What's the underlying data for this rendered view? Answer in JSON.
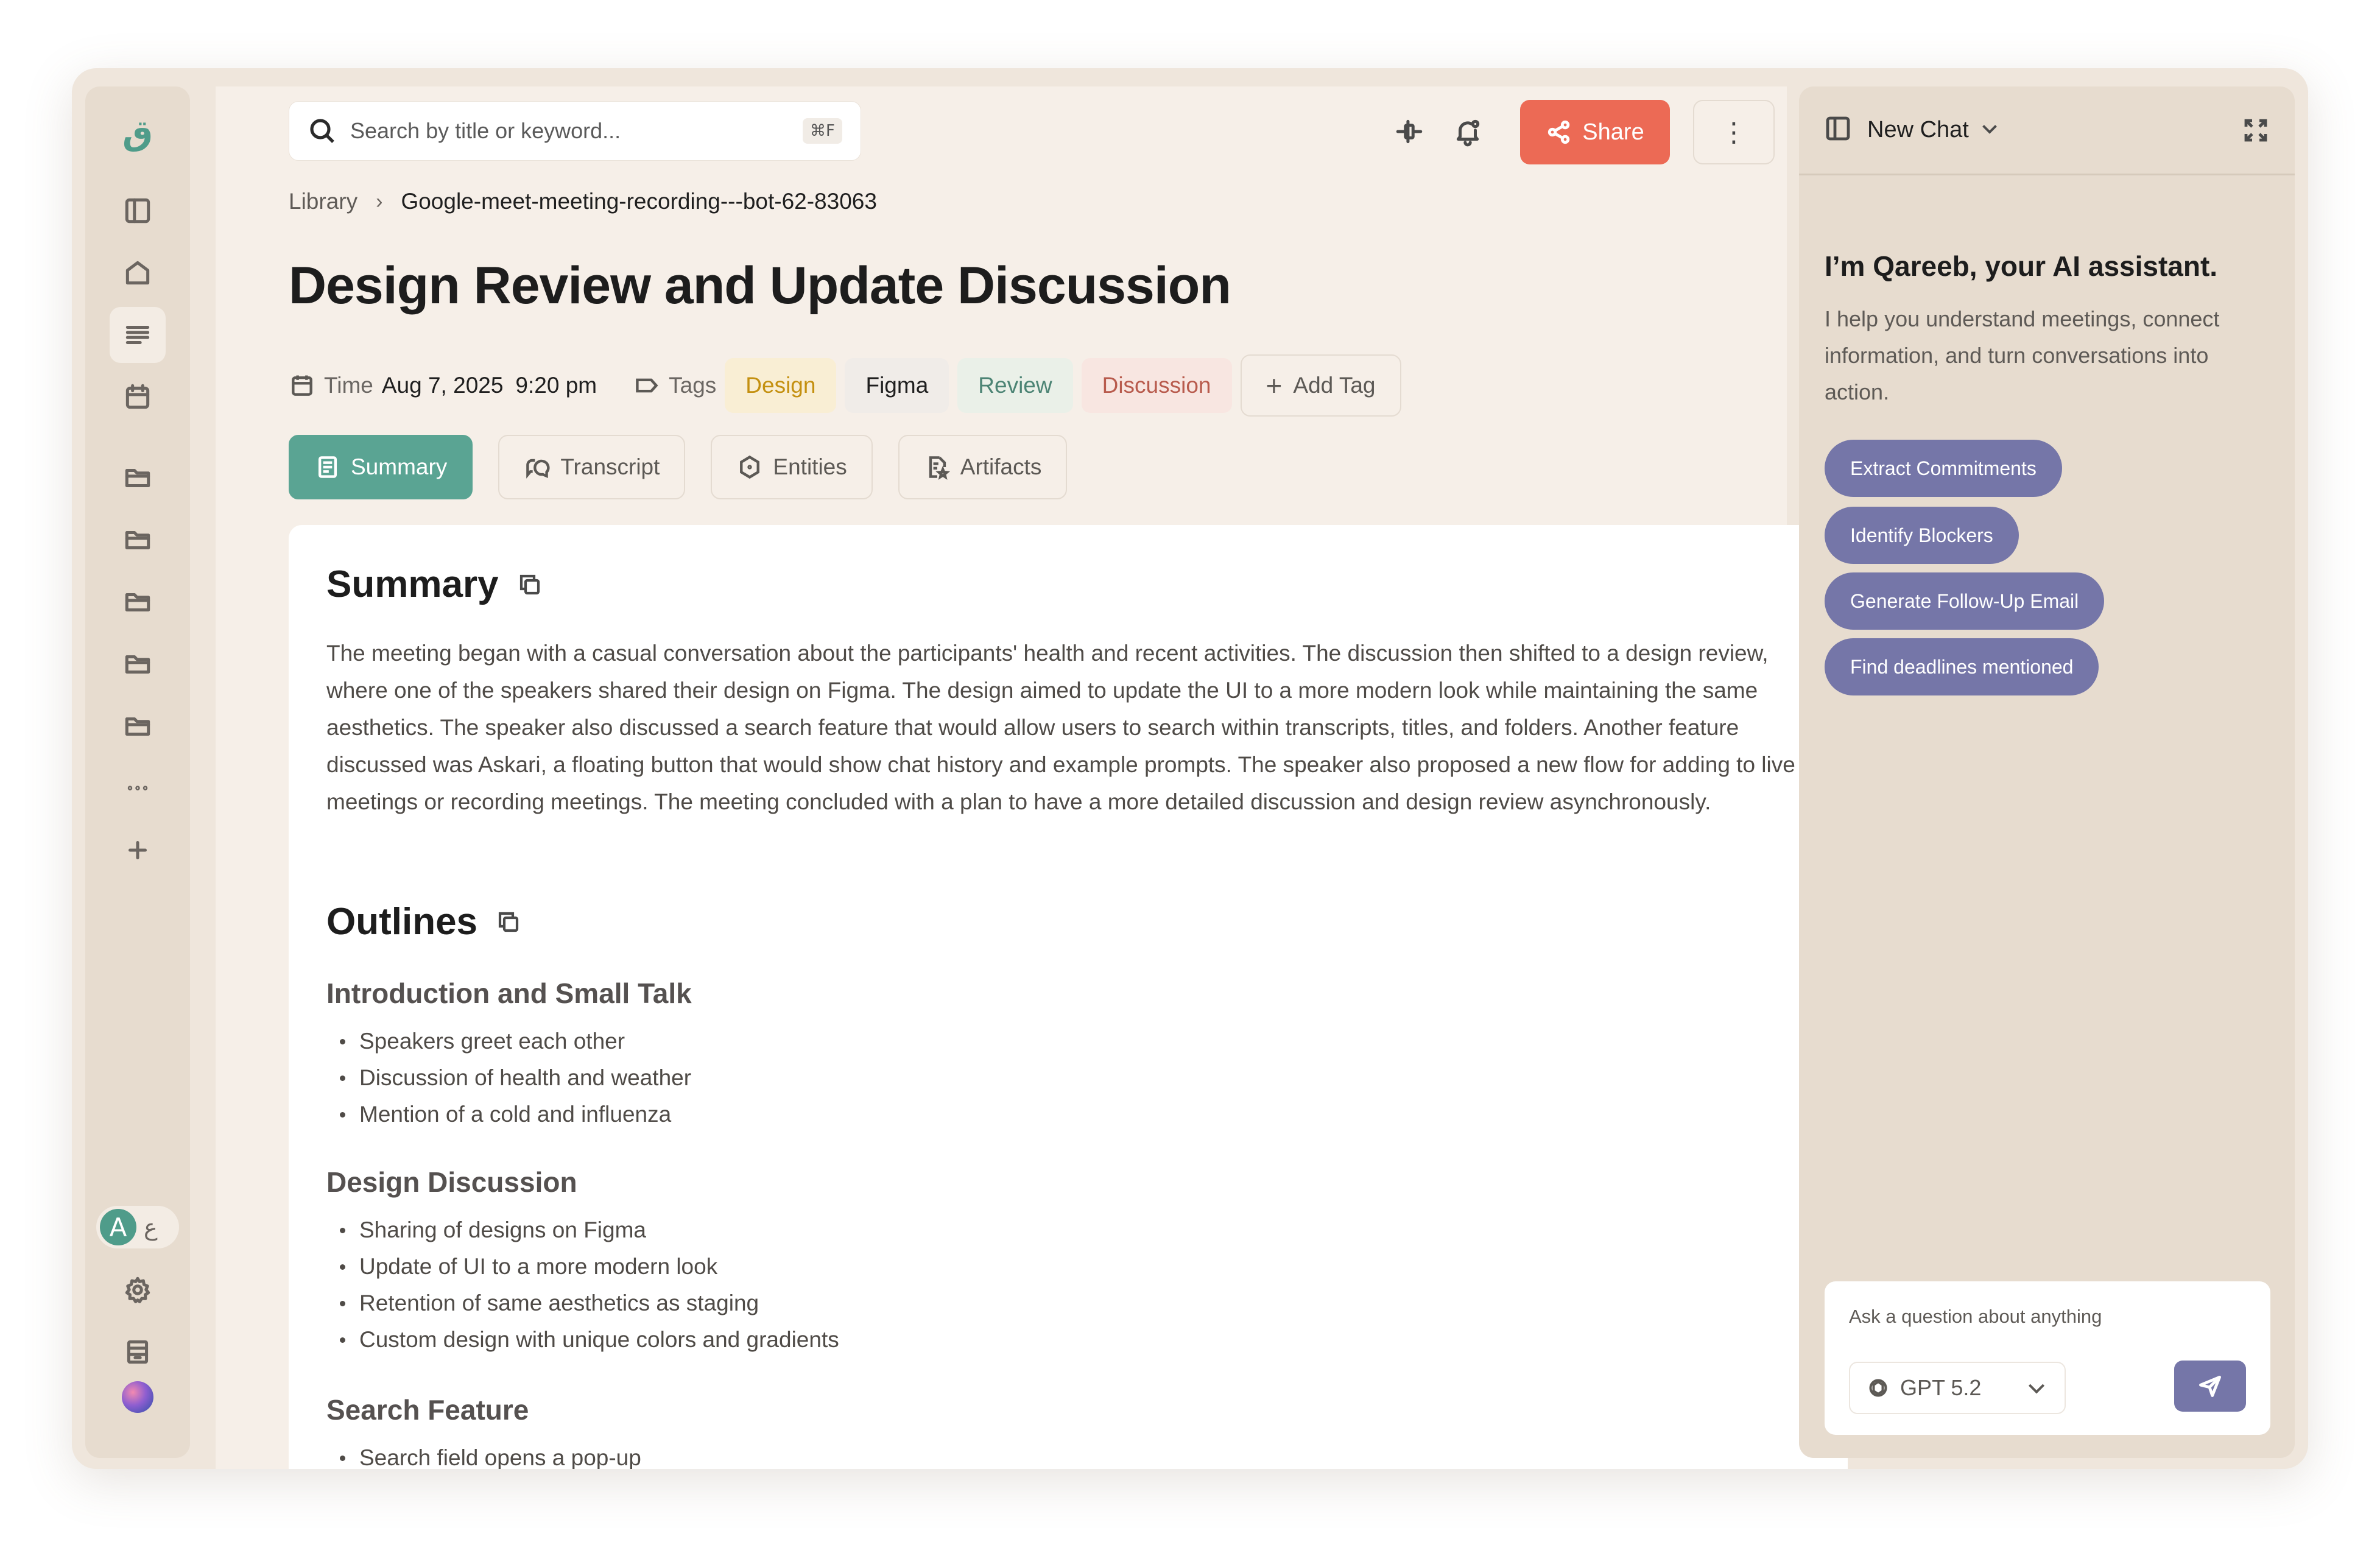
{
  "rail": {
    "logo": "ق",
    "lang_primary": "A",
    "lang_secondary": "ع"
  },
  "search": {
    "placeholder": "Search by title or keyword...",
    "shortcut": "⌘F"
  },
  "header": {
    "share_label": "Share",
    "more_label": "⋮"
  },
  "breadcrumb": {
    "root": "Library",
    "separator": "›",
    "current": "Google-meet-meeting-recording---bot-62-83063"
  },
  "page": {
    "title": "Design Review and Update Discussion",
    "time_label": "Time",
    "date": "Aug 7, 2025",
    "time": "9:20 pm",
    "tags_label": "Tags",
    "tags": [
      {
        "label": "Design",
        "color": "#c49010"
      },
      {
        "label": "Figma",
        "color": "#1f1f1f"
      },
      {
        "label": "Review",
        "color": "#4c8474"
      },
      {
        "label": "Discussion",
        "color": "#b85b4d"
      }
    ],
    "add_tag_label": "Add Tag"
  },
  "tabs": [
    {
      "label": "Summary",
      "active": true
    },
    {
      "label": "Transcript",
      "active": false
    },
    {
      "label": "Entities",
      "active": false
    },
    {
      "label": "Artifacts",
      "active": false
    }
  ],
  "content": {
    "summary_heading": "Summary",
    "summary_text": "The meeting began with a casual conversation about the participants' health and recent activities. The discussion then shifted to a design review, where one of the speakers shared their design on Figma. The design aimed to update the UI to a more modern look while maintaining the same aesthetics. The speaker also discussed a search feature that would allow users to search within transcripts, titles, and folders. Another feature discussed was Askari, a floating button that would show chat history and example prompts. The speaker also proposed a new flow for adding to live meetings or recording meetings. The meeting concluded with a plan to have a more detailed discussion and design review asynchronously.",
    "outlines_heading": "Outlines",
    "outlines": [
      {
        "title": "Introduction and Small Talk",
        "items": [
          "Speakers greet each other",
          "Discussion of health and weather",
          "Mention of a cold and influenza"
        ]
      },
      {
        "title": "Design Discussion",
        "items": [
          "Sharing of designs on Figma",
          "Update of UI to a more modern look",
          "Retention of same aesthetics as staging",
          "Custom design with unique colors and gradients"
        ]
      },
      {
        "title": "Search Feature",
        "items": [
          "Search field opens a pop-up"
        ]
      }
    ]
  },
  "chat": {
    "title": "New Chat",
    "greeting": "I’m Qareeb, your AI assistant.",
    "description": "I help you understand meetings, connect information, and turn conversations into action.",
    "prompts": [
      "Extract Commitments",
      "Identify Blockers",
      "Generate Follow-Up Email",
      "Find deadlines mentioned"
    ],
    "input_placeholder": "Ask a question about anything",
    "model": "GPT 5.2"
  },
  "colors": {
    "accent_green": "#5aa493",
    "share_red": "#ec6a55",
    "prompt_purple": "#7576a8"
  }
}
